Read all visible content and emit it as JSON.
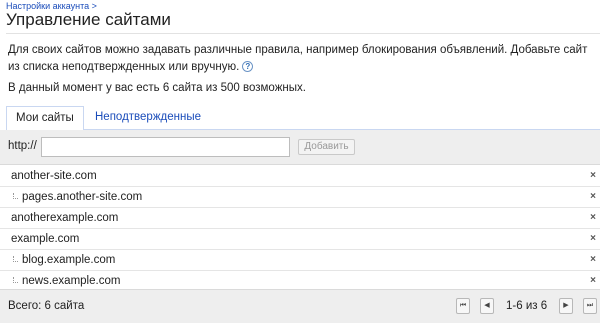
{
  "breadcrumb": "Настройки аккаунта >",
  "page_title": "Управление сайтами",
  "intro": {
    "line1": "Для своих сайтов можно задавать различные правила, например блокирования объявлений. Добавьте сайт",
    "line2": "из списка неподтвержденных или вручную.",
    "help_icon": "help-icon"
  },
  "count_text": "В данный момент у вас есть 6 сайта из 500 возможных.",
  "tabs": [
    {
      "label": "Мои сайты",
      "active": true
    },
    {
      "label": "Неподтвержденные",
      "active": false
    }
  ],
  "add_bar": {
    "prefix": "http://",
    "input_value": "",
    "button_label": "Добавить"
  },
  "sites": [
    {
      "name": "another-site.com",
      "child": false
    },
    {
      "name": "pages.another-site.com",
      "child": true
    },
    {
      "name": "anotherexample.com",
      "child": false
    },
    {
      "name": "example.com",
      "child": false
    },
    {
      "name": "blog.example.com",
      "child": true
    },
    {
      "name": "news.example.com",
      "child": true
    }
  ],
  "remove_symbol": "×",
  "footer": {
    "total_label": "Всего: 6 сайта",
    "range_label": "1-6 из 6",
    "first_symbol": "⏮",
    "prev_symbol": "◀",
    "next_symbol": "▶",
    "last_symbol": "⏭"
  },
  "colors": {
    "link": "#1a4cba",
    "bar_background": "#eeeeee",
    "tab_border": "#c9d7f1"
  }
}
